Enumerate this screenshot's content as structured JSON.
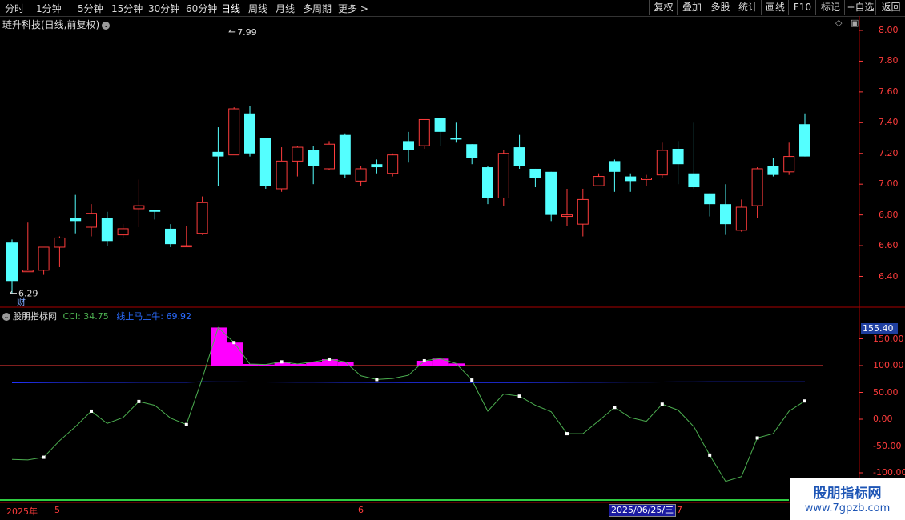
{
  "toolbar": {
    "periods": [
      "分时",
      "1分钟",
      "5分钟",
      "15分钟",
      "30分钟",
      "60分钟",
      "日线",
      "周线",
      "月线",
      "多周期",
      "更多 >"
    ],
    "active_period": "日线",
    "tools": [
      "复权",
      "叠加",
      "多股",
      "统计",
      "画线",
      "F10",
      "标记",
      "+自选",
      "返回"
    ]
  },
  "stock": {
    "title": "琏升科技(日线,前复权)"
  },
  "main_chart": {
    "price_axis": [
      "8.00",
      "7.80",
      "7.60",
      "7.40",
      "7.20",
      "7.00",
      "6.80",
      "6.60",
      "6.40"
    ],
    "high_label": "7.99",
    "low_label": "6.29",
    "fin_marker": "财",
    "colors": {
      "up": "#ff3c3c",
      "down": "#54ffff",
      "axis": "#ff3c3c"
    }
  },
  "indicator": {
    "name": "股朋指标网",
    "cci_label": "CCI: 34.75",
    "line_label": "线上马上牛: 69.92",
    "current_value": "155.40",
    "axis": [
      "150.00",
      "100.00",
      "50.00",
      "0.00",
      "-50.00",
      "-100.00"
    ],
    "colors": {
      "cci": "#4caf50",
      "line": "#2233ff",
      "bar": "#ff00ff"
    }
  },
  "chart_data": {
    "type": "candlestick",
    "ohlc": [
      [
        6.62,
        6.64,
        6.29,
        6.37
      ],
      [
        6.43,
        6.75,
        6.43,
        6.44
      ],
      [
        6.44,
        6.59,
        6.41,
        6.59
      ],
      [
        6.59,
        6.66,
        6.46,
        6.65
      ],
      [
        6.78,
        6.93,
        6.68,
        6.76
      ],
      [
        6.72,
        6.87,
        6.66,
        6.81
      ],
      [
        6.78,
        6.82,
        6.6,
        6.63
      ],
      [
        6.67,
        6.74,
        6.65,
        6.71
      ],
      [
        6.84,
        7.03,
        6.72,
        6.86
      ],
      [
        6.83,
        6.83,
        6.77,
        6.82
      ],
      [
        6.71,
        6.74,
        6.59,
        6.61
      ],
      [
        6.6,
        6.73,
        6.59,
        6.6
      ],
      [
        6.68,
        6.92,
        6.67,
        6.88
      ],
      [
        7.21,
        7.37,
        6.99,
        7.18
      ],
      [
        7.19,
        7.5,
        7.19,
        7.49
      ],
      [
        7.46,
        7.51,
        7.18,
        7.2
      ],
      [
        7.3,
        7.3,
        6.97,
        6.99
      ],
      [
        6.97,
        7.24,
        6.95,
        7.15
      ],
      [
        7.15,
        7.25,
        7.05,
        7.24
      ],
      [
        7.22,
        7.25,
        7.0,
        7.12
      ],
      [
        7.1,
        7.28,
        7.09,
        7.26
      ],
      [
        7.32,
        7.33,
        7.04,
        7.06
      ],
      [
        7.02,
        7.12,
        6.99,
        7.1
      ],
      [
        7.13,
        7.16,
        7.07,
        7.11
      ],
      [
        7.07,
        7.2,
        7.05,
        7.19
      ],
      [
        7.28,
        7.34,
        7.14,
        7.22
      ],
      [
        7.25,
        7.42,
        7.23,
        7.42
      ],
      [
        7.43,
        7.43,
        7.25,
        7.34
      ],
      [
        7.3,
        7.4,
        7.27,
        7.29
      ],
      [
        7.26,
        7.26,
        7.13,
        7.17
      ],
      [
        7.11,
        7.12,
        6.87,
        6.91
      ],
      [
        6.91,
        7.22,
        6.86,
        7.2
      ],
      [
        7.24,
        7.32,
        7.1,
        7.12
      ],
      [
        7.1,
        7.1,
        6.98,
        7.04
      ],
      [
        7.08,
        7.08,
        6.76,
        6.8
      ],
      [
        6.79,
        6.97,
        6.73,
        6.8
      ],
      [
        6.74,
        6.97,
        6.66,
        6.9
      ],
      [
        6.99,
        7.07,
        6.99,
        7.05
      ],
      [
        7.15,
        7.16,
        6.95,
        7.08
      ],
      [
        7.05,
        7.07,
        6.95,
        7.02
      ],
      [
        7.03,
        7.06,
        6.99,
        7.04
      ],
      [
        7.06,
        7.27,
        7.04,
        7.22
      ],
      [
        7.23,
        7.28,
        7.0,
        7.13
      ],
      [
        7.07,
        7.4,
        6.97,
        6.98
      ],
      [
        6.94,
        6.94,
        6.79,
        6.87
      ],
      [
        6.87,
        7.0,
        6.67,
        6.74
      ],
      [
        6.7,
        6.9,
        6.69,
        6.85
      ],
      [
        6.86,
        7.11,
        6.78,
        7.1
      ],
      [
        7.12,
        7.17,
        7.05,
        7.06
      ],
      [
        7.08,
        7.27,
        7.06,
        7.18
      ],
      [
        7.39,
        7.46,
        7.18,
        7.18
      ]
    ],
    "cci": [
      -75,
      -76,
      -71,
      -40,
      -14,
      15,
      -8,
      3,
      33,
      26,
      2,
      -10,
      76,
      171,
      143,
      103,
      102,
      107,
      103,
      107,
      112,
      107,
      81,
      74,
      76,
      82,
      109,
      113,
      104,
      73,
      15,
      47,
      43,
      26,
      14,
      -27,
      -27,
      -3,
      22,
      3,
      -4,
      28,
      17,
      -14,
      -67,
      -116,
      -107,
      -35,
      -27,
      15,
      34
    ],
    "ylim_price": [
      6.2,
      8.05
    ],
    "ylim_cci": [
      -112,
      168
    ],
    "reference_line": 100
  },
  "dates": {
    "year": "2025年",
    "m5": "5",
    "m6": "6",
    "selected": "2025/06/25/三",
    "m7": "7"
  },
  "watermark": {
    "line1": "股朋指标网",
    "line2": "www.7gpzb.com"
  }
}
